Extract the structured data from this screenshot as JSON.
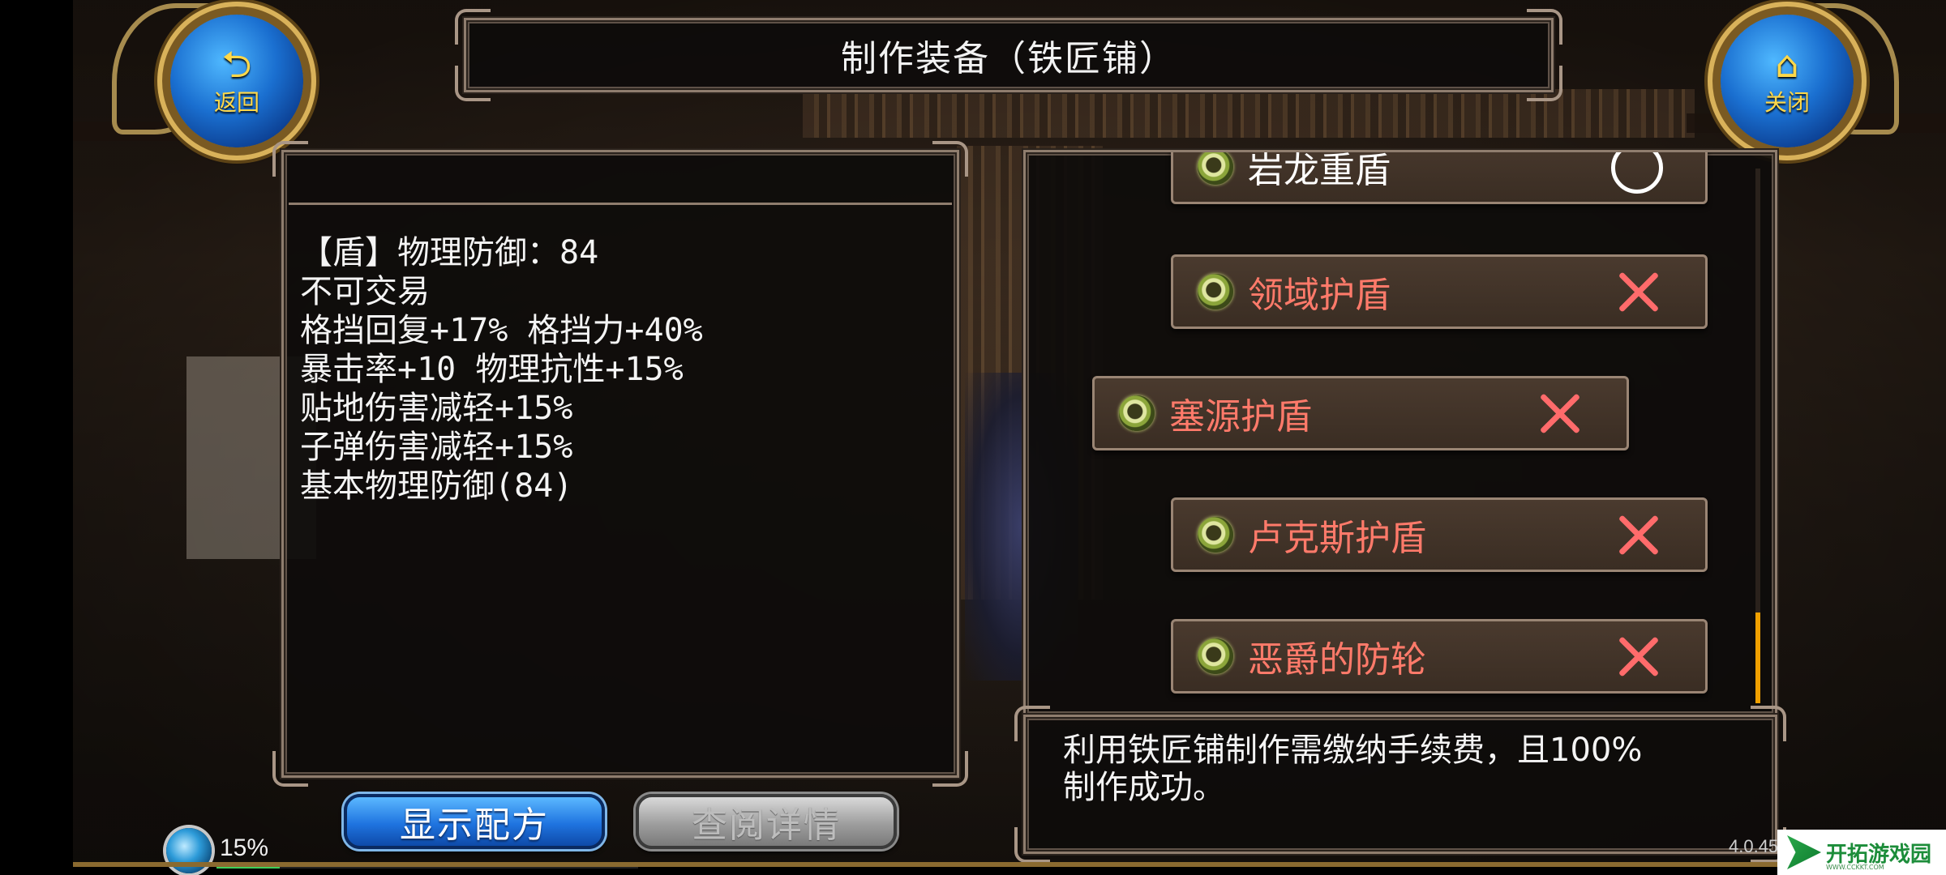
{
  "header": {
    "title": "制作装备（铁匠铺）",
    "back_label": "返回",
    "close_label": "关闭"
  },
  "item_stats": [
    "【盾】物理防御：84",
    "不可交易",
    "格挡回复+17% 格挡力+40%",
    "暴击率+10 物理抗性+15%",
    "贴地伤害减轻+15%",
    "子弹伤害减轻+15%",
    "基本物理防御(84)"
  ],
  "recipes": [
    {
      "name": "岩龙重盾",
      "craftable": true,
      "selected": true
    },
    {
      "name": "领域护盾",
      "craftable": false,
      "selected": false
    },
    {
      "name": "塞源护盾",
      "craftable": false,
      "selected": false
    },
    {
      "name": "卢克斯护盾",
      "craftable": false,
      "selected": false
    },
    {
      "name": "恶爵的防轮",
      "craftable": false,
      "selected": false
    }
  ],
  "description": {
    "line1": "利用铁匠铺制作需缴纳手续费，且100%",
    "line2": "制作成功。"
  },
  "buttons": {
    "show_recipe": "显示配方",
    "view_details": "查阅详情"
  },
  "status_bar": {
    "progress_percent_label": "15%",
    "progress_fraction": 0.15,
    "version": "4.0.45"
  },
  "watermark": {
    "title": "开拓游戏园",
    "subtitle": "WWW.CCKKT.COM"
  },
  "colors": {
    "not_craftable": "#ff7a6a",
    "craftable": "#ffffff",
    "accent_gold": "#ffd84a",
    "scroll_thumb": "#f0a000"
  }
}
